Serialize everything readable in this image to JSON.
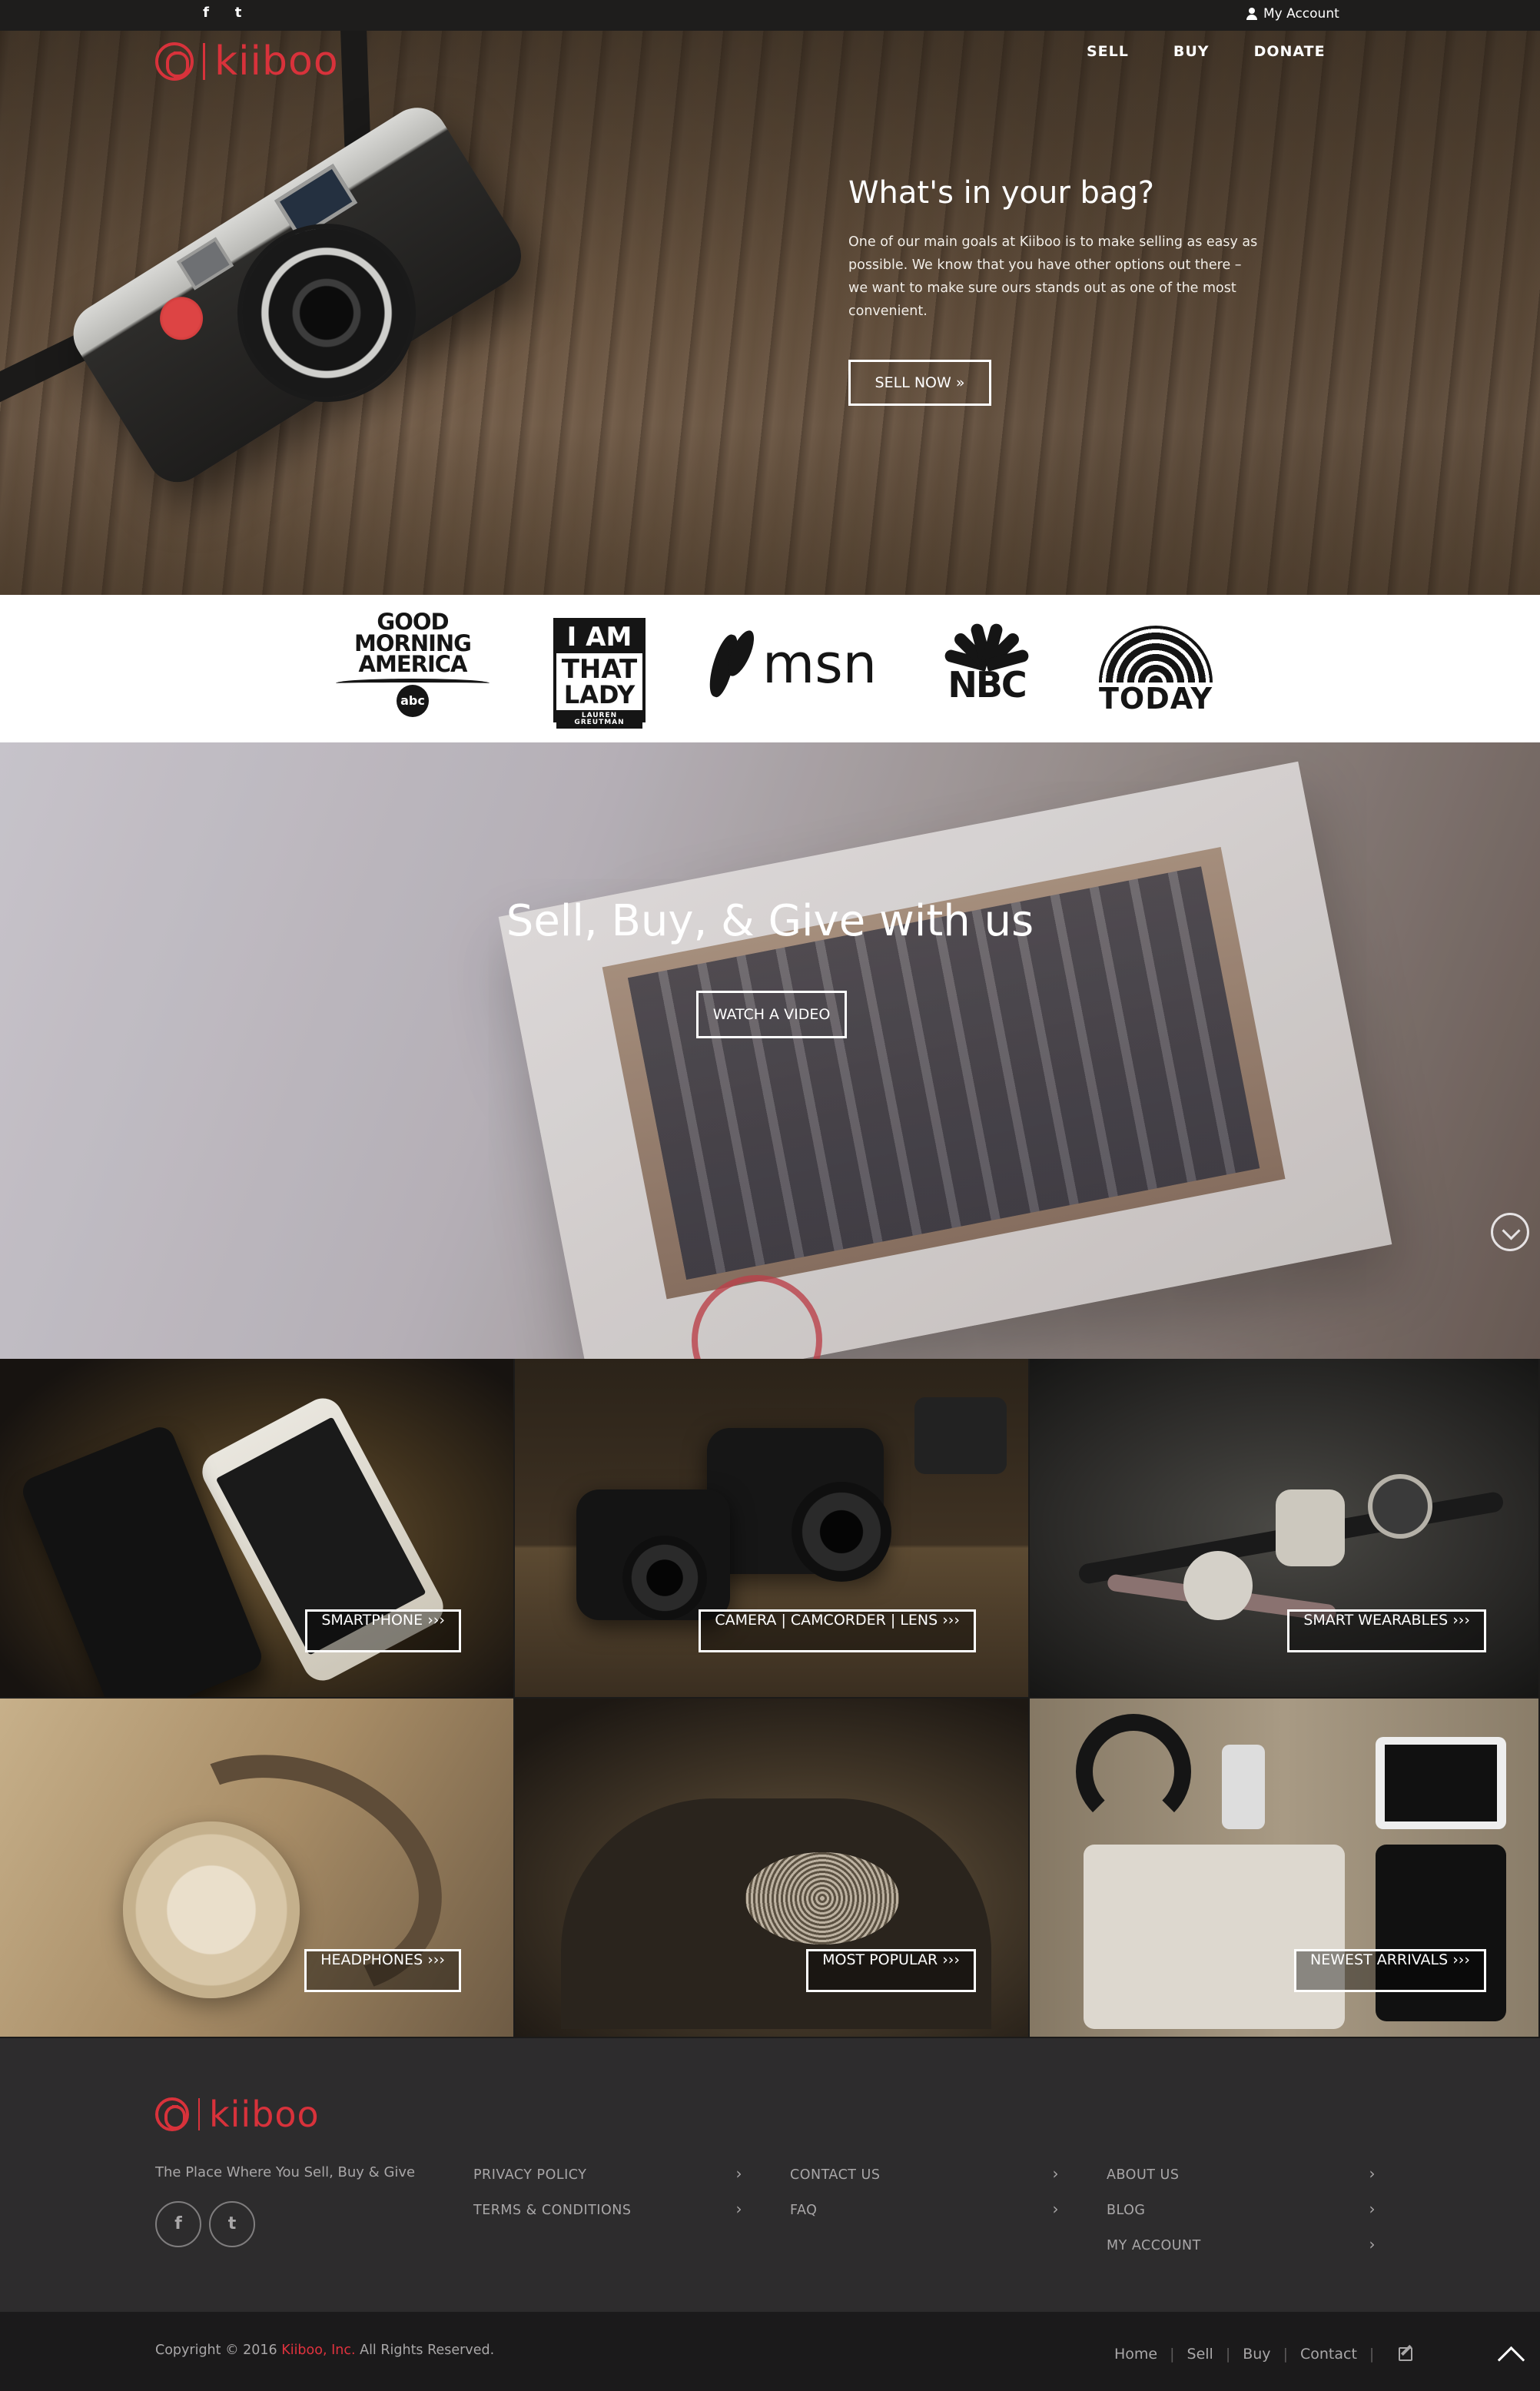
{
  "topbar": {
    "social": [
      {
        "name": "facebook-icon",
        "glyph": "f"
      },
      {
        "name": "twitter-icon",
        "glyph": "t"
      }
    ],
    "account_label": "My Account"
  },
  "brand": {
    "name": "kiiboo",
    "color": "#d8323b"
  },
  "nav": {
    "items": [
      "SELL",
      "BUY",
      "DONATE"
    ]
  },
  "hero": {
    "title": "What's in your bag?",
    "body": "One of our main goals at Kiiboo is to make selling as easy as possible. We know that you have other options out there – we want to make sure ours stands out as one of the most convenient.",
    "cta": "SELL NOW »"
  },
  "press": {
    "gma": [
      "GOOD",
      "MORNING",
      "AMERICA"
    ],
    "gma_badge": "abc",
    "iatl": [
      "I AM",
      "THAT",
      "LADY",
      "LAUREN GREUTMAN"
    ],
    "msn": "msn",
    "nbc": "NBC",
    "today": "TODAY"
  },
  "video": {
    "headline": "Sell, Buy, & Give with us",
    "cta": "WATCH A VIDEO"
  },
  "categories": [
    {
      "label": "SMARTPHONE ›››"
    },
    {
      "label": "CAMERA | CAMCORDER | LENS ›››"
    },
    {
      "label": "SMART WEARABLES ›››"
    },
    {
      "label": "HEADPHONES ›››"
    },
    {
      "label": "MOST POPULAR ›››"
    },
    {
      "label": "NEWEST ARRIVALS ›››"
    }
  ],
  "footer": {
    "tagline": "The Place Where You Sell, Buy & Give",
    "social": [
      "f",
      "t"
    ],
    "col1": [
      "PRIVACY POLICY",
      "TERMS & CONDITIONS"
    ],
    "col2": [
      "CONTACT US",
      "FAQ"
    ],
    "col3": [
      "ABOUT US",
      "BLOG",
      "MY ACCOUNT"
    ],
    "chevron": "›"
  },
  "bottombar": {
    "copyright_prefix": "Copyright © 2016 ",
    "copyright_brand": "Kiiboo, Inc.",
    "copyright_suffix": " All Rights Reserved.",
    "links": [
      "Home",
      "Sell",
      "Buy",
      "Contact"
    ],
    "separator": "|"
  },
  "colors": {
    "accent": "#d8323b",
    "footer_bg": "#2d2c2d",
    "bottombar_bg": "#1b1a1b",
    "footer_text": "#a9a7a8"
  }
}
